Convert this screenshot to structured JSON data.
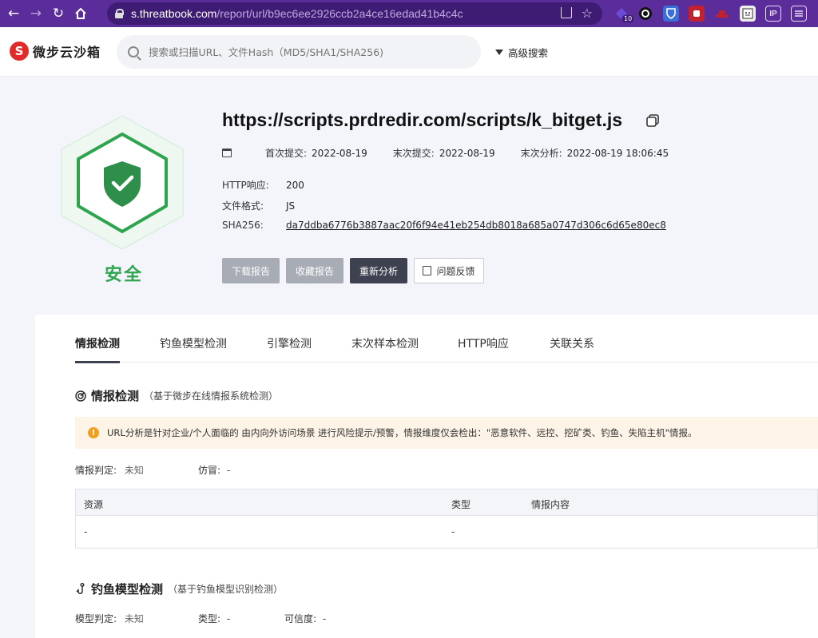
{
  "browser": {
    "url_host": "s.threatbook.com",
    "url_path": "/report/url/b9ec6ee2926ccb2a4ce16edad41b4c4c",
    "extension_badge": "10",
    "colors": {
      "chrome": "#5a2d9a",
      "address_bar": "#3e1c73"
    }
  },
  "header": {
    "logo_text": "微步云沙箱",
    "search_placeholder": "搜索或扫描URL、文件Hash（MD5/SHA1/SHA256)",
    "advanced_search": "高级搜索"
  },
  "report": {
    "verdict": "安全",
    "verdict_color": "#2ea44f",
    "url": "https://scripts.prdredir.com/scripts/k_bitget.js",
    "first_submit_label": "首次提交:",
    "first_submit": "2022-08-19",
    "last_submit_label": "末次提交:",
    "last_submit": "2022-08-19",
    "last_analysis_label": "末次分析:",
    "last_analysis": "2022-08-19 18:06:45",
    "http_label": "HTTP响应:",
    "http_value": "200",
    "format_label": "文件格式:",
    "format_value": "JS",
    "sha_label": "SHA256:",
    "sha_value": "da7ddba6776b3887aac20f6f94e41eb254db8018a685a0747d306c6d65e80ec8",
    "buttons": {
      "download": "下载报告",
      "favorite": "收藏报告",
      "reanalyze": "重新分析",
      "feedback": "问题反馈"
    }
  },
  "tabs": [
    "情报检测",
    "钓鱼模型检测",
    "引擎检测",
    "末次样本检测",
    "HTTP响应",
    "关联关系"
  ],
  "intel": {
    "title": "情报检测",
    "subtitle": "（基于微步在线情报系统检测）",
    "notice": "URL分析是针对企业/个人面临的 由内向外访问场景 进行风险提示/预警，情报维度仅会检出：\"恶意软件、远控、挖矿类、钓鱼、失陷主机\"情报。",
    "judge_label": "情报判定:",
    "judge_value": "未知",
    "counterfeit_label": "仿冒:",
    "counterfeit_value": "-",
    "table_headers": [
      "资源",
      "类型",
      "情报内容"
    ],
    "table_rows": [
      [
        "-",
        "-",
        ""
      ]
    ]
  },
  "phishing": {
    "title": "钓鱼模型检测",
    "subtitle": "（基于钓鱼模型识别检测）",
    "model_label": "模型判定:",
    "model_value": "未知",
    "type_label": "类型:",
    "type_value": "-",
    "confidence_label": "可信度:",
    "confidence_value": "-"
  }
}
